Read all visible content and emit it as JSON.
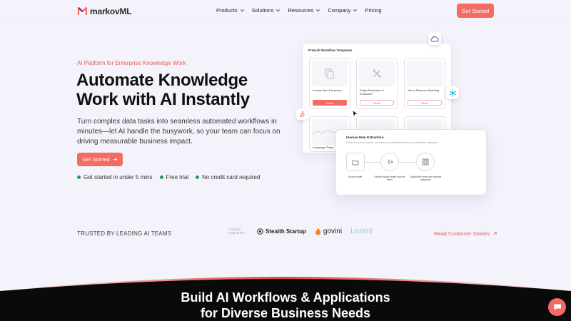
{
  "brand": {
    "name": "markovML",
    "accent": "#f36b63"
  },
  "nav": {
    "items": [
      {
        "label": "Products",
        "dropdown": true
      },
      {
        "label": "Solutions",
        "dropdown": true
      },
      {
        "label": "Resources",
        "dropdown": true
      },
      {
        "label": "Company",
        "dropdown": true
      },
      {
        "label": "Pricing",
        "dropdown": false
      }
    ],
    "cta_label": "Get Started"
  },
  "hero": {
    "eyebrow": "AI Platform for Enterprise Knowledge Work",
    "headline": "Automate Knowledge Work with AI Instantly",
    "subheadline": "Turn complex data tasks into seamless automated workflows in minutes—let AI handle the busywork, so your team can focus on driving measurable business impact.",
    "cta_label": "Get Started",
    "checks": [
      "Get started in under 5 mins",
      "Free trial",
      "No credit card required"
    ]
  },
  "templates_panel": {
    "title": "Prebuilt Workflow Templates",
    "cards": [
      {
        "label": "Invoice Item Extraction",
        "clone": "Clone"
      },
      {
        "label": "Entity Resolution & Extraction",
        "clone": "Clone"
      },
      {
        "label": "Job to Resume Matching",
        "clone": "Clone"
      },
      {
        "label": "Language Trans",
        "clone": ""
      }
    ]
  },
  "workflow_detail": {
    "title": "Invoice Item Extraction",
    "description": "Extract items from invoices, and classify the extracted line items into predefined categories",
    "nodes": [
      {
        "label": "Invoice folder"
      },
      {
        "label": "Extract invoice details and line items"
      },
      {
        "label": "Classify line items into expense categories"
      }
    ]
  },
  "trusted": {
    "label": "TRUSTED BY LEADING AI TEAMS",
    "logos": [
      "LEADING PUBLISHER",
      "Stealth Startup",
      "govini",
      "Learni"
    ],
    "stories_link": "Read Customer Stories"
  },
  "section2": {
    "title_line1": "Build AI Workflows & Applications",
    "title_line2": "for Diverse Business Needs"
  },
  "icons": {
    "chevron": "chevron-down-icon",
    "arrow": "arrow-right-icon",
    "chat": "chat-bubble-icon"
  }
}
